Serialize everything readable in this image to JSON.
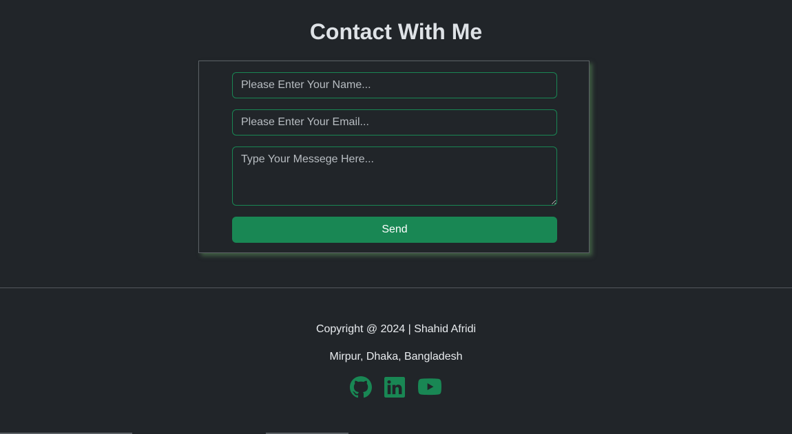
{
  "contact": {
    "title": "Contact With Me",
    "name_placeholder": "Please Enter Your Name...",
    "email_placeholder": "Please Enter Your Email...",
    "message_placeholder": "Type Your Messege Here...",
    "send_label": "Send"
  },
  "footer": {
    "copyright": "Copyright @ 2024 | Shahid Afridi",
    "address": "Mirpur, Dhaka, Bangladesh",
    "socials": [
      {
        "icon": "github-icon"
      },
      {
        "icon": "linkedin-icon"
      },
      {
        "icon": "youtube-icon"
      }
    ]
  },
  "colors": {
    "background": "#212529",
    "accent": "#198754",
    "text": "#dee2e6"
  }
}
